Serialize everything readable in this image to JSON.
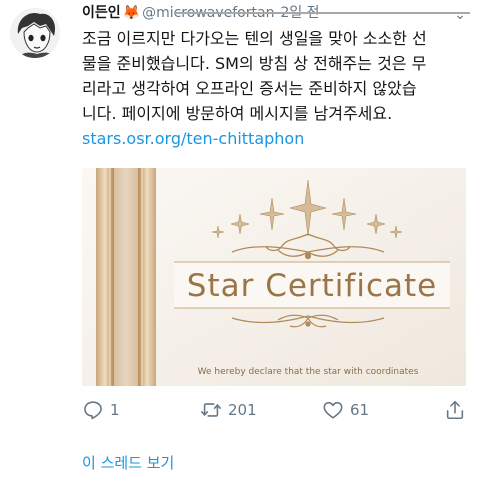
{
  "tweet": {
    "author_name": "이든인",
    "author_emoji": "🦊",
    "handle": "@microwavefortan",
    "time": "2일 전",
    "text_lines": [
      "조금 이르지만 다가오는 텐의 생일을 맞아 소소한 선",
      "물을 준비했습니다. SM의 방침 상 전해주는 것은 무",
      "리라고 생각하여 오프라인 증서는 준비하지 않았습",
      "니다. 페이지에 방문하여 메시지를 남겨주세요."
    ],
    "link": "stars.osr.org/ten-chittaphon",
    "card": {
      "title": "Star Certificate",
      "subtitle": "We hereby declare that the star with coordinates"
    },
    "actions": {
      "replies": "1",
      "retweets": "201",
      "likes": "61"
    },
    "thread_link": "이 스레드 보기"
  },
  "colors": {
    "link_blue": "#1b95e0",
    "meta_gray": "#657786",
    "card_gold": "#b08a5a",
    "card_bg": "#f6f2ec"
  },
  "icons": [
    "avatar-illustration",
    "reply-icon",
    "retweet-icon",
    "like-icon",
    "share-icon",
    "caret-down-icon"
  ]
}
